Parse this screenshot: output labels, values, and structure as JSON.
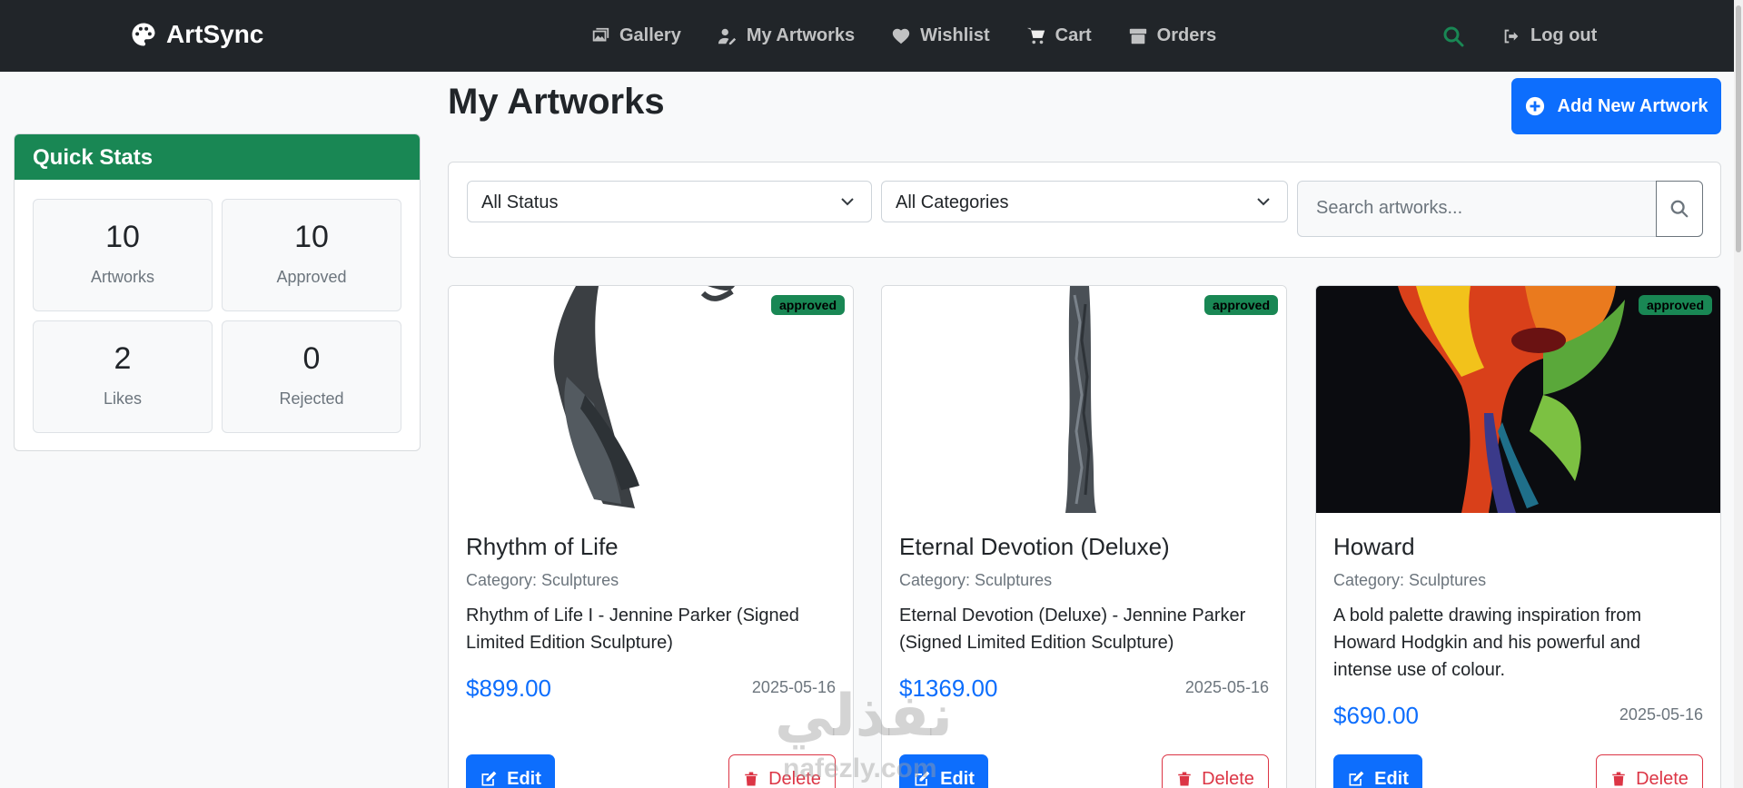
{
  "navbar": {
    "brand": "ArtSync",
    "links": [
      {
        "label": "Gallery",
        "icon": "images-icon"
      },
      {
        "label": "My Artworks",
        "icon": "user-pen-icon"
      },
      {
        "label": "Wishlist",
        "icon": "heart-icon"
      },
      {
        "label": "Cart",
        "icon": "cart-icon"
      },
      {
        "label": "Orders",
        "icon": "box-icon"
      }
    ],
    "search_icon_color": "#198754",
    "logout_label": "Log out"
  },
  "quick_stats": {
    "title": "Quick Stats",
    "items": [
      {
        "value": "10",
        "label": "Artworks"
      },
      {
        "value": "10",
        "label": "Approved"
      },
      {
        "value": "2",
        "label": "Likes"
      },
      {
        "value": "0",
        "label": "Rejected"
      }
    ]
  },
  "main": {
    "title": "My Artworks",
    "add_button": "Add New Artwork",
    "filters": {
      "status_selected": "All Status",
      "category_selected": "All Categories",
      "search_placeholder": "Search artworks..."
    },
    "artworks": [
      {
        "status": "approved",
        "title": "Rhythm of Life",
        "category": "Category: Sculptures",
        "description": "Rhythm of Life I - Jennine Parker (Signed Limited Edition Sculpture)",
        "price": "$899.00",
        "date": "2025-05-16",
        "edit": "Edit",
        "delete": "Delete"
      },
      {
        "status": "approved",
        "title": "Eternal Devotion (Deluxe)",
        "category": "Category: Sculptures",
        "description": "Eternal Devotion (Deluxe) - Jennine Parker (Signed Limited Edition Sculpture)",
        "price": "$1369.00",
        "date": "2025-05-16",
        "edit": "Edit",
        "delete": "Delete"
      },
      {
        "status": "approved",
        "title": "Howard",
        "category": "Category: Sculptures",
        "description": "A bold palette drawing inspiration from Howard Hodgkin and his powerful and intense use of colour.",
        "price": "$690.00",
        "date": "2025-05-16",
        "edit": "Edit",
        "delete": "Delete"
      }
    ]
  },
  "colors": {
    "navbar": "#212529",
    "primary": "#0d6efd",
    "success": "#198754",
    "danger": "#dc3545"
  },
  "watermark": {
    "arabic": "نفذلي",
    "latin": "nafezly.com"
  }
}
